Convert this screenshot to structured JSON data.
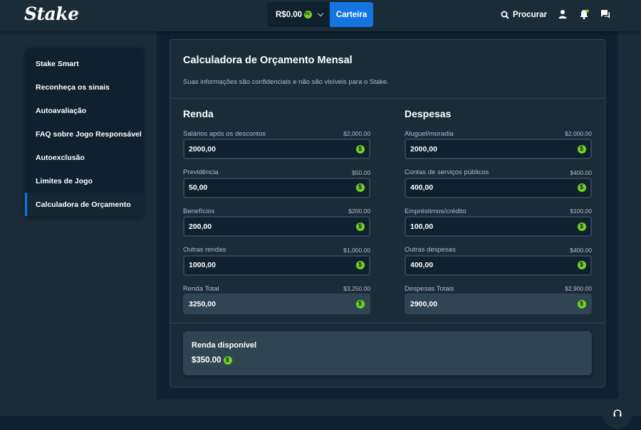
{
  "header": {
    "logo": "Stake",
    "balance": "R$0.00",
    "wallet_label": "Carteira",
    "search_label": "Procurar",
    "icons": [
      "search-icon",
      "user-icon",
      "notifications-icon",
      "chat-icon"
    ]
  },
  "sidebar": {
    "items": [
      {
        "label": "Stake Smart"
      },
      {
        "label": "Reconheça os sinais"
      },
      {
        "label": "Autoavaliação"
      },
      {
        "label": "FAQ sobre Jogo Responsável"
      },
      {
        "label": "Autoexclusão"
      },
      {
        "label": "Limites de Jogo"
      },
      {
        "label": "Calculadora de Orçamento",
        "active": true
      }
    ]
  },
  "calculator": {
    "title": "Calculadora de Orçamento Mensal",
    "subtitle": "Suas informações são confidenciais e não são visíveis para o Stake.",
    "income": {
      "title": "Renda",
      "fields": [
        {
          "label": "Salários após os descontos",
          "amount": "$2,000.00",
          "value": "2000,00"
        },
        {
          "label": "Previdência",
          "amount": "$50.00",
          "value": "50,00"
        },
        {
          "label": "Benefícios",
          "amount": "$200.00",
          "value": "200,00"
        },
        {
          "label": "Outras rendas",
          "amount": "$1,000.00",
          "value": "1000,00"
        }
      ],
      "total": {
        "label": "Renda Total",
        "amount": "$3,250.00",
        "value": "3250,00"
      }
    },
    "expenses": {
      "title": "Despesas",
      "fields": [
        {
          "label": "Aluguel/moradia",
          "amount": "$2,000.00",
          "value": "2000,00"
        },
        {
          "label": "Contas de serviços públicos",
          "amount": "$400.00",
          "value": "400,00"
        },
        {
          "label": "Empréstimos/crédito",
          "amount": "$100.00",
          "value": "100,00"
        },
        {
          "label": "Outras despesas",
          "amount": "$400.00",
          "value": "400,00"
        }
      ],
      "total": {
        "label": "Despesas Totais",
        "amount": "$2,900.00",
        "value": "2900,00"
      }
    },
    "available": {
      "label": "Renda disponível",
      "value": "$350.00"
    }
  },
  "colors": {
    "background": "#1a2c38",
    "panel": "#0f212e",
    "border": "#2f4553",
    "accent": "#1475e1",
    "coin": "#78d21e"
  }
}
